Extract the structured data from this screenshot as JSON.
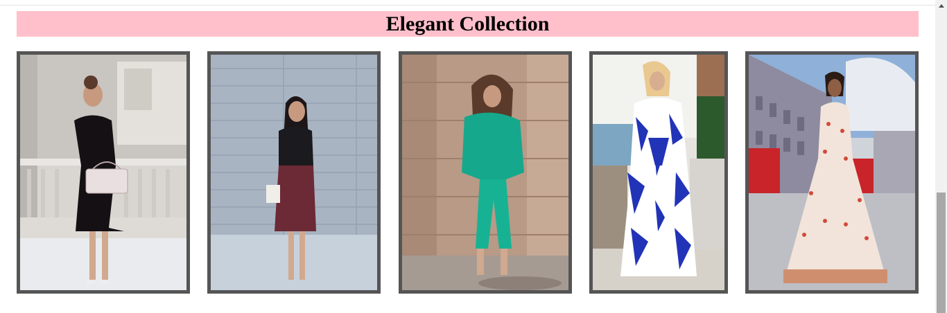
{
  "header": {
    "title": "Elegant Collection",
    "banner_color": "#ffc0cb"
  },
  "gallery": {
    "frame_color": "#555555",
    "items": [
      {
        "outfit": "black-dress",
        "setting": "stone-building"
      },
      {
        "outfit": "burgundy-skirt",
        "setting": "concrete-wall"
      },
      {
        "outfit": "green-suit",
        "setting": "sandstone-wall"
      },
      {
        "outfit": "blue-print-coat",
        "setting": "terrace"
      },
      {
        "outfit": "floral-jumpsuit",
        "setting": "london-street"
      }
    ]
  },
  "scrollbar": {
    "up_arrow_icon": "triangle-up-icon"
  }
}
